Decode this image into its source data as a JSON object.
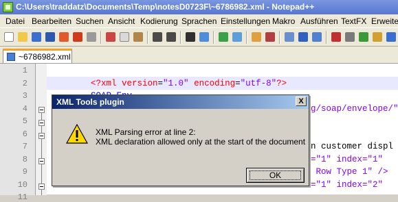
{
  "window": {
    "title": "C:\\Users\\traddatz\\Documents\\Temp\\notesD0723F\\~6786982.xml - Notepad++"
  },
  "menu": [
    "Datei",
    "Bearbeiten",
    "Suchen",
    "Ansicht",
    "Kodierung",
    "Sprachen",
    "Einstellungen",
    "Makro",
    "Ausführen",
    "TextFX",
    "Erweite"
  ],
  "tabs": [
    {
      "label": "~6786982.xml"
    }
  ],
  "editor": {
    "line_numbers": [
      "1",
      "2",
      "3",
      "4",
      "5",
      "6",
      "7",
      "8",
      "9",
      "10",
      "11"
    ],
    "visible_code": {
      "line2": {
        "open": "<?xml ",
        "attr1": "version",
        "eq": "=",
        "val1": "\"1.0\"",
        "attr2": " encoding",
        "val2": "\"utf-8\"",
        "close": "?>"
      },
      "line3": "SOAP-Env",
      "line4": "g/soap/envelope/\"",
      "line7": "n customer displ",
      "line8_a": "=\"1\" index=\"1\"",
      "line9": " Row Type 1\" />",
      "line10": "=\"1\" index=\"2\""
    }
  },
  "dialog": {
    "title": "XML Tools plugin",
    "close_label": "X",
    "message_line1": "XML Parsing error at line 2:",
    "message_line2": "XML declaration allowed only at the start of the document",
    "ok_label": "OK"
  },
  "colors": {
    "tag": "#0000ff",
    "attr": "#ff0000",
    "value": "#8000ff",
    "pi": "#ff0000",
    "active_tab_accent": "#f7a130"
  }
}
